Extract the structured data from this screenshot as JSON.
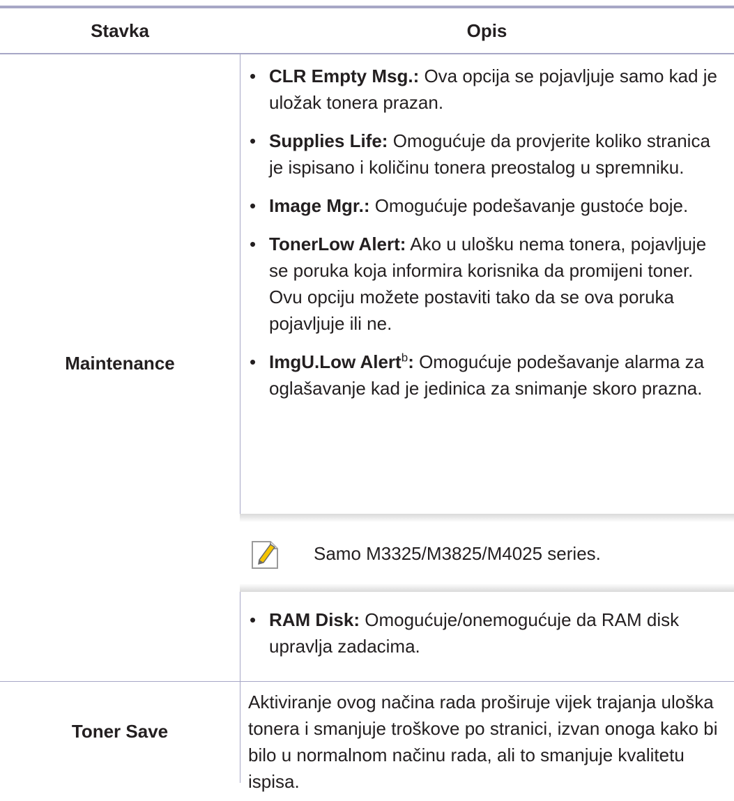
{
  "table": {
    "headers": {
      "item": "Stavka",
      "description": "Opis"
    },
    "rows": [
      {
        "item": "Maintenance",
        "bullets": [
          {
            "term": "CLR Empty Msg.:",
            "text": " Ova opcija se pojavljuje samo kad je uložak tonera prazan."
          },
          {
            "term": "Supplies Life:",
            "text": " Omogućuje da provjerite koliko stranica je ispisano i količinu tonera preostalog u spremniku."
          },
          {
            "term": "Image Mgr.:",
            "text": " Omogućuje podešavanje gustoće boje."
          },
          {
            "term": "TonerLow Alert:",
            "text": " Ako u ulošku nema tonera, pojavljuje se poruka koja informira korisnika da promijeni toner. Ovu opciju možete postaviti tako da se ova poruka pojavljuje ili ne."
          },
          {
            "term": "ImgU.Low Alert",
            "sup": "b",
            "term_suffix": ":",
            "text": " Omogućuje podešavanje alarma za oglašavanje kad je jedinica za snimanje skoro prazna."
          }
        ],
        "note": {
          "icon": "note-pencil-icon",
          "text": "Samo M3325/M3825/M4025 series."
        },
        "extra_bullet": {
          "term": "RAM Disk:",
          "text": " Omogućuje/onemogućuje da RAM disk upravlja zadacima."
        }
      },
      {
        "item": "Toner Save",
        "description": "Aktiviranje ovog načina rada proširuje vijek trajanja uloška tonera i smanjuje troškove po stranici, izvan onoga kako bi bilo u normalnom načinu rada, ali to smanjuje kvalitetu ispisa."
      }
    ]
  },
  "colors": {
    "rule": "#a7a7c6",
    "text": "#231f20",
    "note_band": "#d9d9d9",
    "icon_accent": "#f5c400"
  }
}
